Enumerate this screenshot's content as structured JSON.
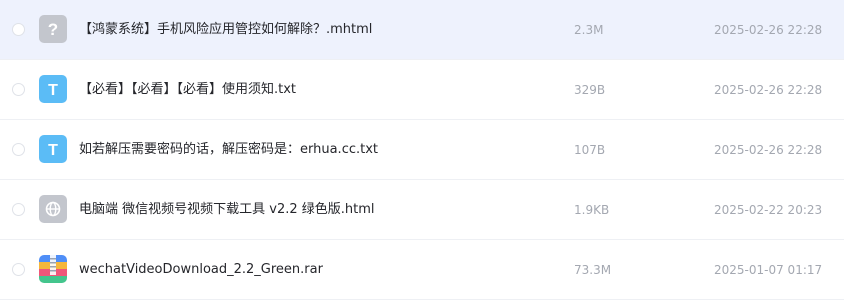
{
  "files": [
    {
      "icon": "unknown-file-icon",
      "name": "【鸿蒙系统】手机风险应用管控如何解除？.mhtml",
      "size": "2.3M",
      "date": "2025-02-26 22:28"
    },
    {
      "icon": "text-file-icon",
      "name": "【必看】【必看】【必看】使用须知.txt",
      "size": "329B",
      "date": "2025-02-26 22:28"
    },
    {
      "icon": "text-file-icon",
      "name": "如若解压需要密码的话，解压密码是：erhua.cc.txt",
      "size": "107B",
      "date": "2025-02-26 22:28"
    },
    {
      "icon": "web-file-icon",
      "name": "电脑端 微信视频号视频下载工具 v2.2 绿色版.html",
      "size": "1.9KB",
      "date": "2025-02-22 20:23"
    },
    {
      "icon": "archive-file-icon",
      "name": "wechatVideoDownload_2.2_Green.rar",
      "size": "73.3M",
      "date": "2025-01-07 01:17"
    }
  ],
  "colors": {
    "hover_row": "#eef2fd",
    "text_icon": "#5bbcf6",
    "unknown_icon": "#c3c6cd",
    "web_icon": "#c3c6cd",
    "secondary_text": "#a4a8b1"
  }
}
